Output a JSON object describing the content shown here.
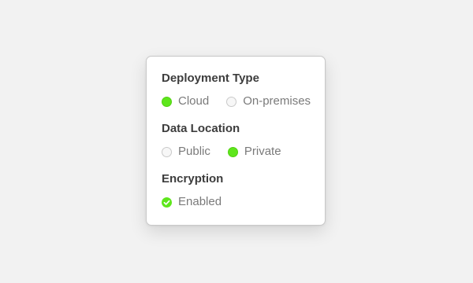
{
  "colors": {
    "accent": "#5ee61c",
    "background": "#f2f2f2",
    "card": "#ffffff"
  },
  "deployment": {
    "title": "Deployment Type",
    "options": [
      {
        "label": "Cloud",
        "selected": true
      },
      {
        "label": "On-premises",
        "selected": false
      }
    ]
  },
  "data_location": {
    "title": "Data Location",
    "options": [
      {
        "label": "Public",
        "selected": false
      },
      {
        "label": "Private",
        "selected": true
      }
    ]
  },
  "encryption": {
    "title": "Encryption",
    "option": {
      "label": "Enabled",
      "checked": true,
      "icon": "check-icon"
    }
  }
}
